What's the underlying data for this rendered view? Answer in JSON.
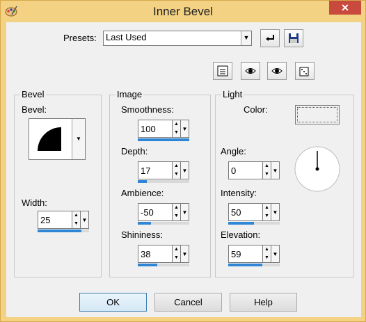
{
  "window": {
    "title": "Inner Bevel",
    "close_glyph": "✕"
  },
  "presets": {
    "label": "Presets:",
    "value": "Last Used"
  },
  "toolbar": [
    "save-preset-icon",
    "reset-icon",
    "dialog-layout-icon",
    "proof-icon",
    "auto-proof-icon",
    "randomize-icon"
  ],
  "bevel": {
    "group_title": "Bevel",
    "bevel_label": "Bevel:",
    "width_label": "Width:",
    "width": {
      "value": "25",
      "fraction": 0.85
    }
  },
  "image": {
    "group_title": "Image",
    "smoothness_label": "Smoothness:",
    "smoothness": {
      "value": "100",
      "fraction": 1.0
    },
    "depth_label": "Depth:",
    "depth": {
      "value": "17",
      "fraction": 0.17
    },
    "ambience_label": "Ambience:",
    "ambience": {
      "value": "-50",
      "fraction": 0.25
    },
    "shininess_label": "Shininess:",
    "shininess": {
      "value": "38",
      "fraction": 0.38
    }
  },
  "light": {
    "group_title": "Light",
    "color_label": "Color:",
    "angle_label": "Angle:",
    "angle": {
      "value": "0",
      "fraction": 0.0
    },
    "intensity_label": "Intensity:",
    "intensity": {
      "value": "50",
      "fraction": 0.5
    },
    "elevation_label": "Elevation:",
    "elevation": {
      "value": "59",
      "fraction": 0.66
    }
  },
  "buttons": {
    "ok": "OK",
    "cancel": "Cancel",
    "help": "Help"
  }
}
